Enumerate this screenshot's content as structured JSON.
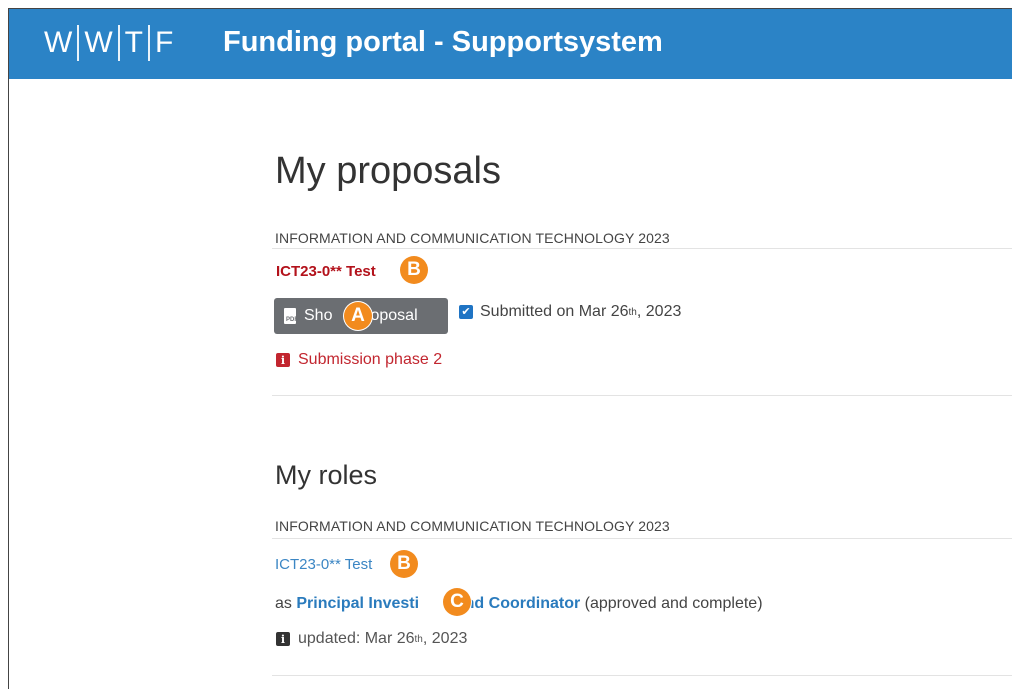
{
  "header": {
    "logo_letters": [
      "W",
      "W",
      "T",
      "F"
    ],
    "title": "Funding portal - Supportsystem",
    "bar_color": "#2b83c6"
  },
  "proposals": {
    "heading": "My proposals",
    "category": "INFORMATION AND COMMUNICATION TECHNOLOGY 2023",
    "proposal_title": "ICT23-0** Test",
    "show_button_label_a": "Sho",
    "show_button_label_b": "oposal",
    "status_text": "Submitted on Mar 26",
    "status_sup": "th",
    "status_year": ", 2023",
    "phase_text": "Submission phase 2",
    "phase_color": "#c2262f"
  },
  "roles": {
    "heading": "My roles",
    "category": "INFORMATION AND COMMUNICATION TECHNOLOGY 2023",
    "proposal_title": "ICT23-0** Test",
    "as_prefix": "as",
    "role_link_a": "Principal Investi",
    "role_link_b": "r and Coordinator",
    "role_status": "(approved and complete)",
    "updated_text": "updated: Mar 26",
    "updated_sup": "th",
    "updated_year": ", 2023"
  },
  "callouts": {
    "a": "A",
    "b": "B",
    "c": "C",
    "color": "#f28b1e"
  },
  "icons": {
    "pdf": "pdf-icon",
    "check": "checkbox-icon",
    "info": "info-icon"
  }
}
